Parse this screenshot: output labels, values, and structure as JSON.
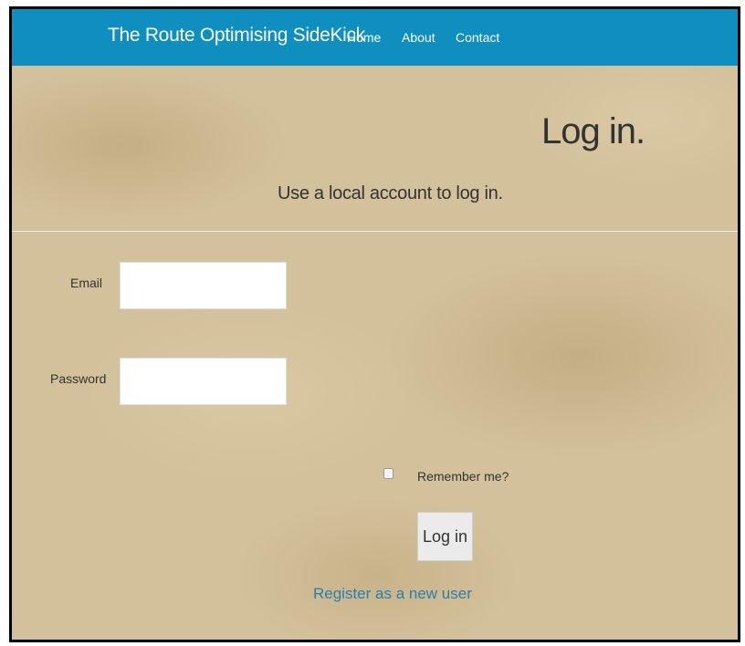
{
  "navbar": {
    "brand": "The Route Optimising SideKick",
    "links": [
      "Home",
      "About",
      "Contact"
    ],
    "color": "#0f8fc0"
  },
  "page": {
    "title": "Log in.",
    "subtitle": "Use a local account to log in."
  },
  "form": {
    "email_label": "Email",
    "email_value": "",
    "password_label": "Password",
    "password_value": "",
    "remember_label": "Remember me?",
    "remember_checked": false,
    "submit_label": "Log in"
  },
  "register_link": "Register as a new user"
}
